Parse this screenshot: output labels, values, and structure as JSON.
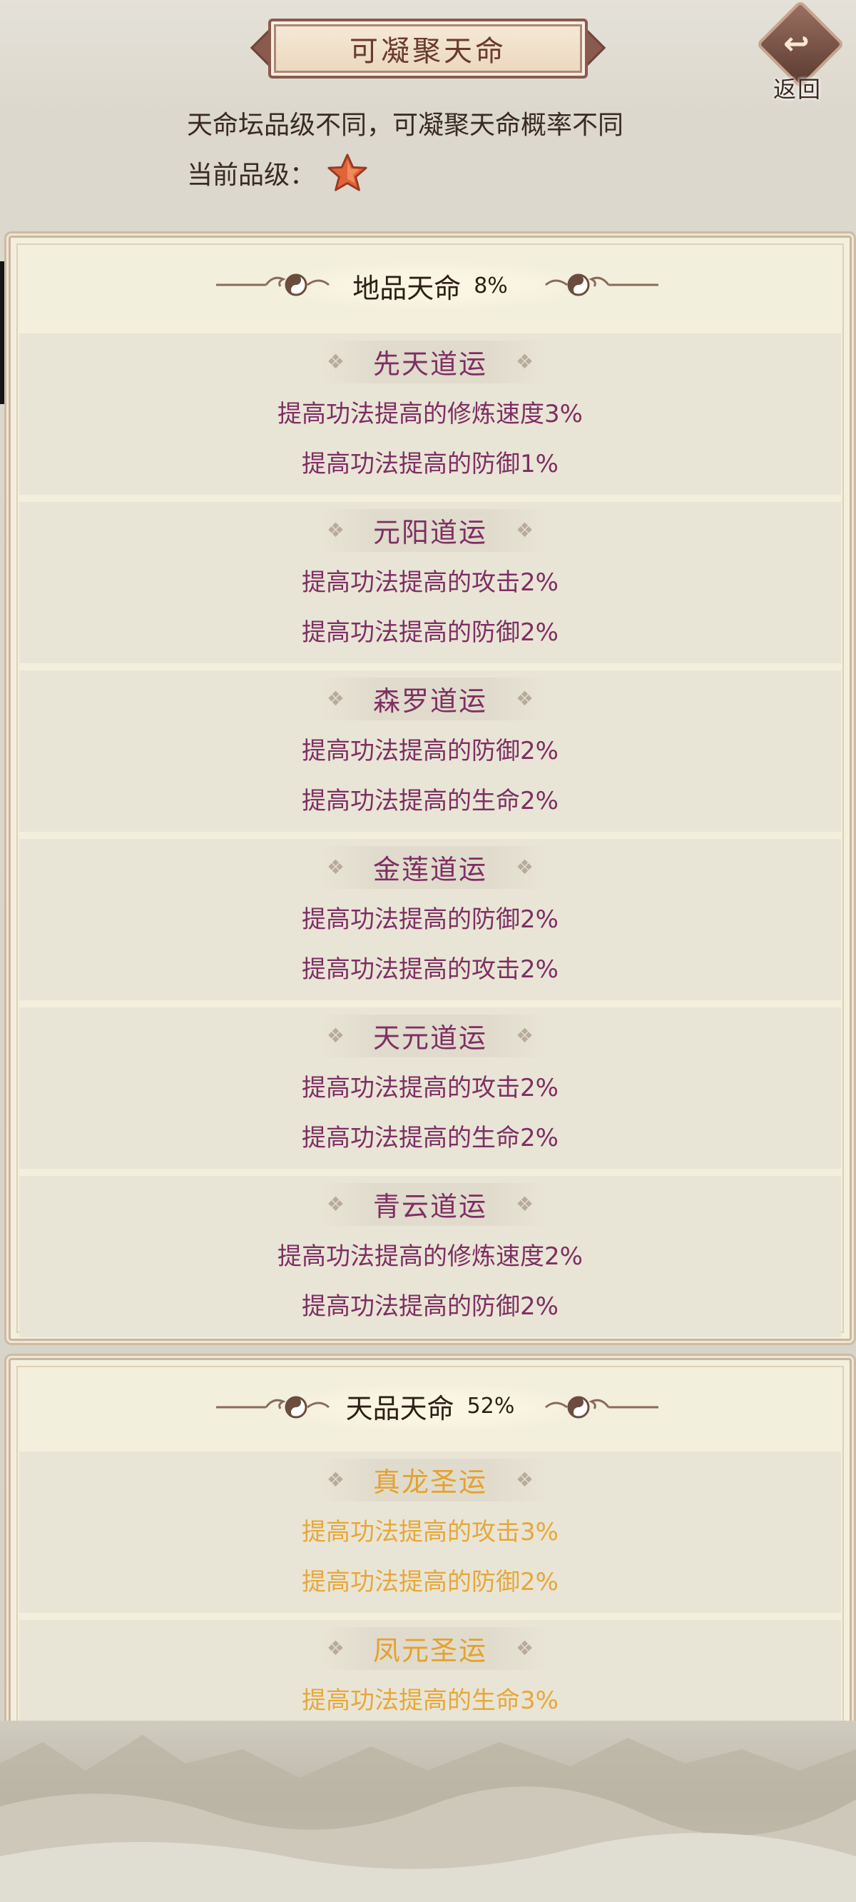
{
  "header": {
    "title": "可凝聚天命",
    "back_label": "返回",
    "intro": "天命坛品级不同，可凝聚天命概率不同",
    "grade_label": "当前品级："
  },
  "panels": [
    {
      "name": "地品天命",
      "percent": "8%",
      "cards": [
        {
          "title": "先天道运",
          "lines": [
            "提高功法提高的修炼速度3%",
            "提高功法提高的防御1%"
          ]
        },
        {
          "title": "元阳道运",
          "lines": [
            "提高功法提高的攻击2%",
            "提高功法提高的防御2%"
          ]
        },
        {
          "title": "森罗道运",
          "lines": [
            "提高功法提高的防御2%",
            "提高功法提高的生命2%"
          ]
        },
        {
          "title": "金莲道运",
          "lines": [
            "提高功法提高的防御2%",
            "提高功法提高的攻击2%"
          ]
        },
        {
          "title": "天元道运",
          "lines": [
            "提高功法提高的攻击2%",
            "提高功法提高的生命2%"
          ]
        },
        {
          "title": "青云道运",
          "lines": [
            "提高功法提高的修炼速度2%",
            "提高功法提高的防御2%"
          ]
        }
      ]
    },
    {
      "name": "天品天命",
      "percent": "52%",
      "cards": [
        {
          "title": "真龙圣运",
          "lines": [
            "提高功法提高的攻击3%",
            "提高功法提高的防御2%"
          ]
        },
        {
          "title": "凤元圣运",
          "lines": [
            "提高功法提高的生命3%"
          ]
        }
      ]
    }
  ],
  "colors": {
    "earth_text": "#7e2f63",
    "heaven_text": "#e3a22f",
    "panel_bg": "#f3efdd",
    "card_bg": "#e9e5d6"
  },
  "icons": {
    "grade": "star-icon",
    "back": "back-arrow-icon",
    "ornament": "taiji-scroll-ornament-icon",
    "card_deco": "diamond-deco-icon"
  }
}
